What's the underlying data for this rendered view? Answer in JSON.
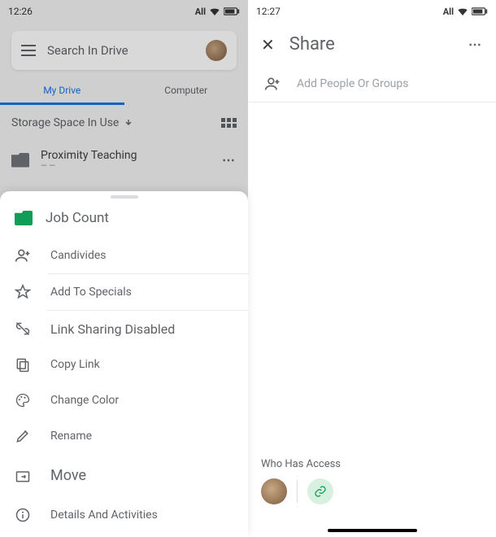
{
  "left": {
    "status_time": "12:26",
    "status_net": "All",
    "search_placeholder": "Search In Drive",
    "tab_my_drive": "My Drive",
    "tab_computer": "Computer",
    "storage_label": "Storage Space In Use",
    "folder1_name": "Proximity Teaching"
  },
  "sheet": {
    "title": "Job Count",
    "items": {
      "share": "Candivides",
      "star": "Add To Specials",
      "linkshare": "Link Sharing Disabled",
      "copylink": "Copy Link",
      "color": "Change Color",
      "rename": "Rename",
      "move": "Move",
      "details": "Details And Activities"
    }
  },
  "right": {
    "status_time": "12:27",
    "status_net": "All",
    "share_title": "Share",
    "add_placeholder": "Add People Or Groups",
    "access_label": "Who Has Access"
  }
}
